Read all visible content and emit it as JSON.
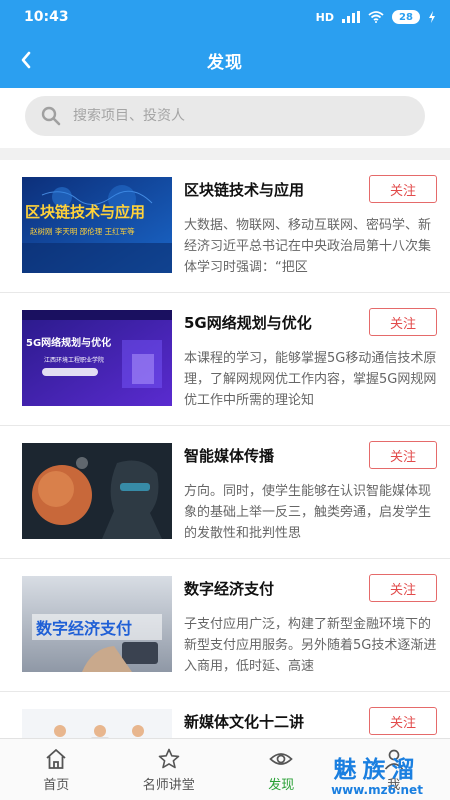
{
  "status_bar": {
    "time": "10:43",
    "network": "HD",
    "battery": "28"
  },
  "header": {
    "title": "发现",
    "back_icon": "back-arrow-icon"
  },
  "search": {
    "placeholder": "搜索项目、投资人",
    "icon": "search-icon"
  },
  "items": [
    {
      "title": "区块链技术与应用",
      "follow": "关注",
      "desc": "大数据、物联网、移动互联网、密码学、新经济习近平总书记在中央政治局第十八次集体学习时强调：“把区",
      "thumb_title": "区块链技术与应用",
      "thumb_names": "赵树刚  李天明  邵伦理  王红军等"
    },
    {
      "title": "5G网络规划与优化",
      "follow": "关注",
      "desc": "本课程的学习，能够掌握5G移动通信技术原理，了解网规网优工作内容，掌握5G网规网优工作中所需的理论知",
      "thumb_title": "5G网络规划与优化",
      "thumb_org": "江西环境工程职业学院"
    },
    {
      "title": "智能媒体传播",
      "follow": "关注",
      "desc": "方向。同时，使学生能够在认识智能媒体现象的基础上举一反三，触类旁通，启发学生的发散性和批判性思"
    },
    {
      "title": "数字经济支付",
      "follow": "关注",
      "desc": "子支付应用广泛，构建了新型金融环境下的新型支付应用服务。另外随着5G技术逐渐进入商用，低时延、高速",
      "thumb_title": "数字经济支付"
    },
    {
      "title": "新媒体文化十二讲",
      "follow": "关注",
      "desc": ""
    }
  ],
  "bottom_nav": [
    {
      "label": "首页",
      "icon": "home-icon"
    },
    {
      "label": "名师讲堂",
      "icon": "star-icon"
    },
    {
      "label": "发现",
      "icon": "eye-icon",
      "active": true
    },
    {
      "label": "我",
      "icon": "person-icon"
    }
  ],
  "watermark": {
    "title": "魅族溜",
    "url": "www.mz6.net"
  },
  "colors": {
    "header": "#2b9ff0",
    "follow": "#e24b4b",
    "active_tab": "#2aa037",
    "watermark": "#1a7fe0"
  }
}
